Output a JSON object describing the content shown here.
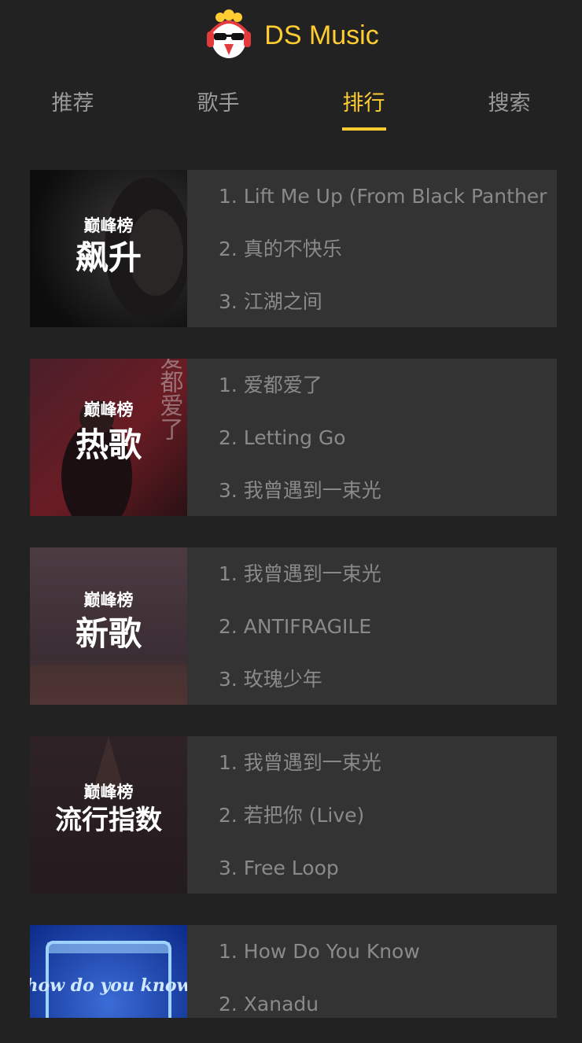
{
  "app": {
    "title": "DS Music"
  },
  "colors": {
    "accent": "#ffcd32",
    "background": "#222222",
    "card": "#333333",
    "muted": "#8a8a8a"
  },
  "tabs": [
    {
      "label": "推荐",
      "active": false
    },
    {
      "label": "歌手",
      "active": false
    },
    {
      "label": "排行",
      "active": true
    },
    {
      "label": "搜索",
      "active": false
    }
  ],
  "ranks": [
    {
      "cover_brand": "巅峰榜",
      "cover_name": "飙升",
      "songs": [
        "1. Lift Me Up (From Black Panther",
        "2. 真的不快乐",
        "3. 江湖之间"
      ]
    },
    {
      "cover_brand": "巅峰榜",
      "cover_name": "热歌",
      "cover_deco": "爱都爱了",
      "songs": [
        "1. 爱都爱了",
        "2. Letting Go",
        "3. 我曾遇到一束光"
      ]
    },
    {
      "cover_brand": "巅峰榜",
      "cover_name": "新歌",
      "songs": [
        "1. 我曾遇到一束光",
        "2. ANTIFRAGILE",
        "3. 玫瑰少年"
      ]
    },
    {
      "cover_brand": "巅峰榜",
      "cover_name": "流行指数",
      "songs": [
        "1. 我曾遇到一束光",
        "2. 若把你 (Live)",
        "3. Free Loop"
      ]
    },
    {
      "cover_name": "how do you know",
      "songs": [
        "1. How Do You Know",
        "2. Xanadu"
      ]
    }
  ]
}
